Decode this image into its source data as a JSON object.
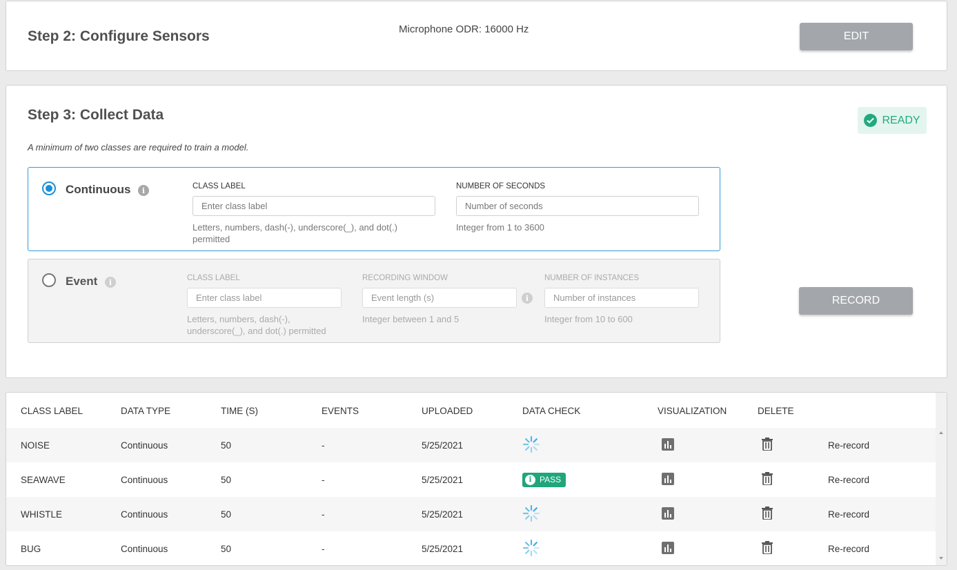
{
  "step2": {
    "title": "Step 2: Configure Sensors",
    "odr_text": "Microphone ODR: 16000 Hz",
    "edit_label": "EDIT"
  },
  "step3": {
    "title": "Step 3: Collect Data",
    "status_label": "READY",
    "note": "A minimum of two classes are required to train a model.",
    "record_label": "RECORD",
    "continuous": {
      "name": "Continuous",
      "selected": true,
      "class_label": "CLASS LABEL",
      "class_placeholder": "Enter class label",
      "class_hint": "Letters, numbers, dash(-), underscore(_), and dot(.) permitted",
      "seconds_label": "NUMBER OF SECONDS",
      "seconds_placeholder": "Number of seconds",
      "seconds_hint": "Integer from 1 to 3600"
    },
    "event": {
      "name": "Event",
      "selected": false,
      "class_label": "CLASS LABEL",
      "class_placeholder": "Enter class label",
      "class_hint": "Letters, numbers, dash(-), underscore(_), and dot(.) permitted",
      "window_label": "RECORDING WINDOW",
      "window_placeholder": "Event length (s)",
      "window_hint": "Integer between 1 and 5",
      "instances_label": "NUMBER OF INSTANCES",
      "instances_placeholder": "Number of instances",
      "instances_hint": "Integer from 10 to 600"
    }
  },
  "table": {
    "headers": [
      "CLASS LABEL",
      "DATA TYPE",
      "TIME (S)",
      "EVENTS",
      "UPLOADED",
      "DATA CHECK",
      "VISUALIZATION",
      "DELETE",
      ""
    ],
    "rows": [
      {
        "class_label": "NOISE",
        "data_type": "Continuous",
        "time": "50",
        "events": "-",
        "uploaded": "5/25/2021",
        "check": "loading",
        "rerecord": "Re-record"
      },
      {
        "class_label": "SEAWAVE",
        "data_type": "Continuous",
        "time": "50",
        "events": "-",
        "uploaded": "5/25/2021",
        "check": "PASS",
        "rerecord": "Re-record"
      },
      {
        "class_label": "WHISTLE",
        "data_type": "Continuous",
        "time": "50",
        "events": "-",
        "uploaded": "5/25/2021",
        "check": "loading",
        "rerecord": "Re-record"
      },
      {
        "class_label": "BUG",
        "data_type": "Continuous",
        "time": "50",
        "events": "-",
        "uploaded": "5/25/2021",
        "check": "loading",
        "rerecord": "Re-record"
      }
    ]
  },
  "colors": {
    "accent_blue": "#1a8fd9",
    "ready_green": "#22aa7e",
    "pass_green": "#1fa67b",
    "spinner_blue": "#2ea7e0",
    "button_gray": "#a3a6ab"
  }
}
